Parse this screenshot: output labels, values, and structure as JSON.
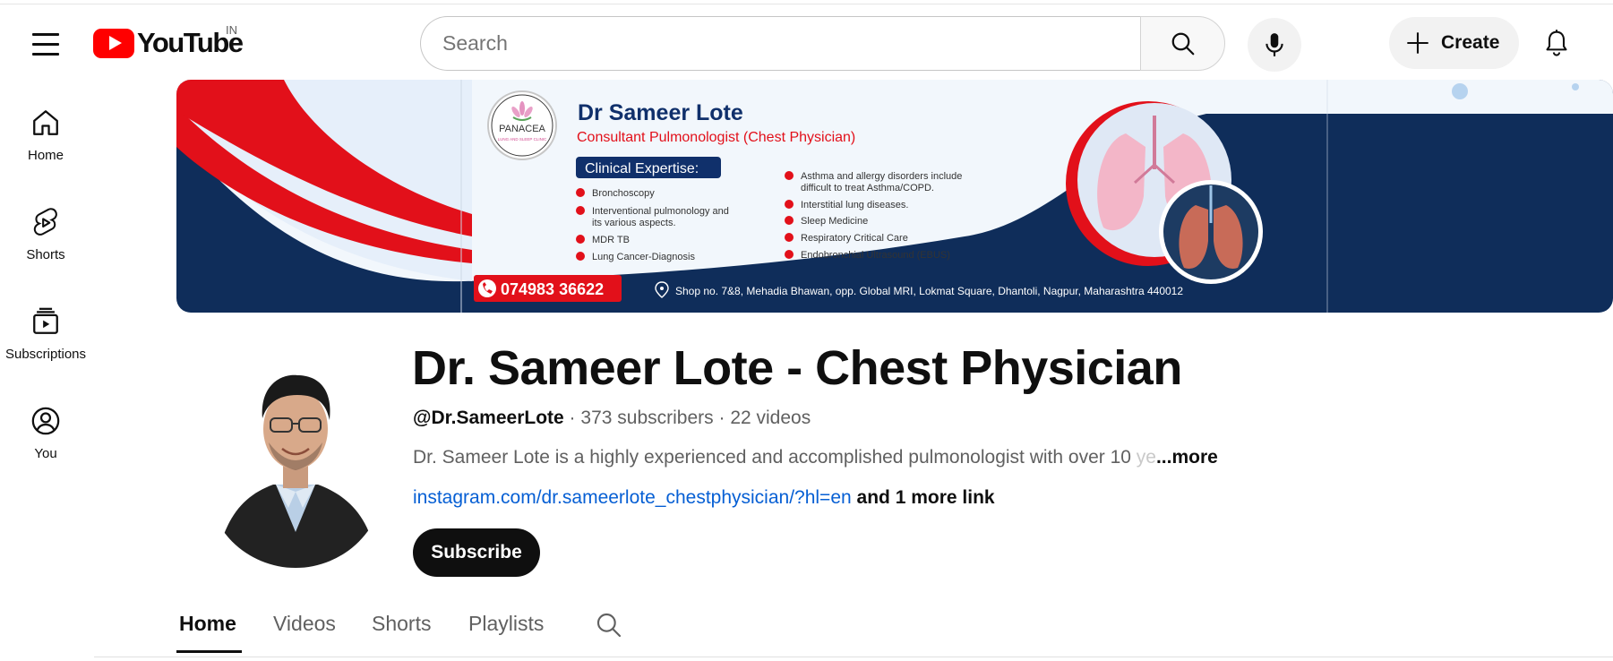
{
  "masthead": {
    "logo_text": "YouTube",
    "country_code": "IN",
    "search_placeholder": "Search",
    "create_label": "Create",
    "icons": [
      "menu-icon",
      "search-icon",
      "mic-icon",
      "plus-icon",
      "bell-icon"
    ]
  },
  "sidebar": {
    "items": [
      {
        "label": "Home",
        "icon": "home-icon"
      },
      {
        "label": "Shorts",
        "icon": "shorts-icon"
      },
      {
        "label": "Subscriptions",
        "icon": "subscriptions-icon"
      },
      {
        "label": "You",
        "icon": "you-icon"
      }
    ]
  },
  "banner": {
    "clinic_name": "PANACEA",
    "clinic_tagline": "LUNG AND SLEEP CLINIC",
    "doctor_name": "Dr Sameer Lote",
    "designation": "Consultant Pulmonologist (Chest Physician)",
    "expertise_heading": "Clinical Expertise:",
    "expertise_left": [
      "Bronchoscopy",
      "Interventional pulmonology and",
      "its various aspects.",
      "MDR TB",
      "Lung Cancer-Diagnosis"
    ],
    "expertise_right": [
      "Asthma and allergy disorders include",
      "difficult to treat Asthma/COPD.",
      "Interstitial lung diseases.",
      "Sleep Medicine",
      "Respiratory Critical Care",
      "Endobronchial Ultrasound (EBUS)"
    ],
    "phone": "074983 36622",
    "address": "Shop no. 7&8, Mehadia Bhawan, opp. Global MRI, Lokmat Square, Dhantoli, Nagpur, Maharashtra 440012"
  },
  "channel": {
    "name": "Dr. Sameer Lote - Chest Physician",
    "handle": "@Dr.SameerLote",
    "separator": " · ",
    "subscribers": "373 subscribers",
    "videos": "22 videos",
    "description": "Dr. Sameer Lote is a highly experienced and accomplished pulmonologist with over 10",
    "description_fade": " ye",
    "more_label": "...more",
    "link": "instagram.com/dr.sameerlote_chestphysician/?hl=en",
    "more_links": "and 1 more link",
    "subscribe_label": "Subscribe"
  },
  "tabs": [
    {
      "label": "Home",
      "active": true
    },
    {
      "label": "Videos",
      "active": false
    },
    {
      "label": "Shorts",
      "active": false
    },
    {
      "label": "Playlists",
      "active": false
    }
  ]
}
